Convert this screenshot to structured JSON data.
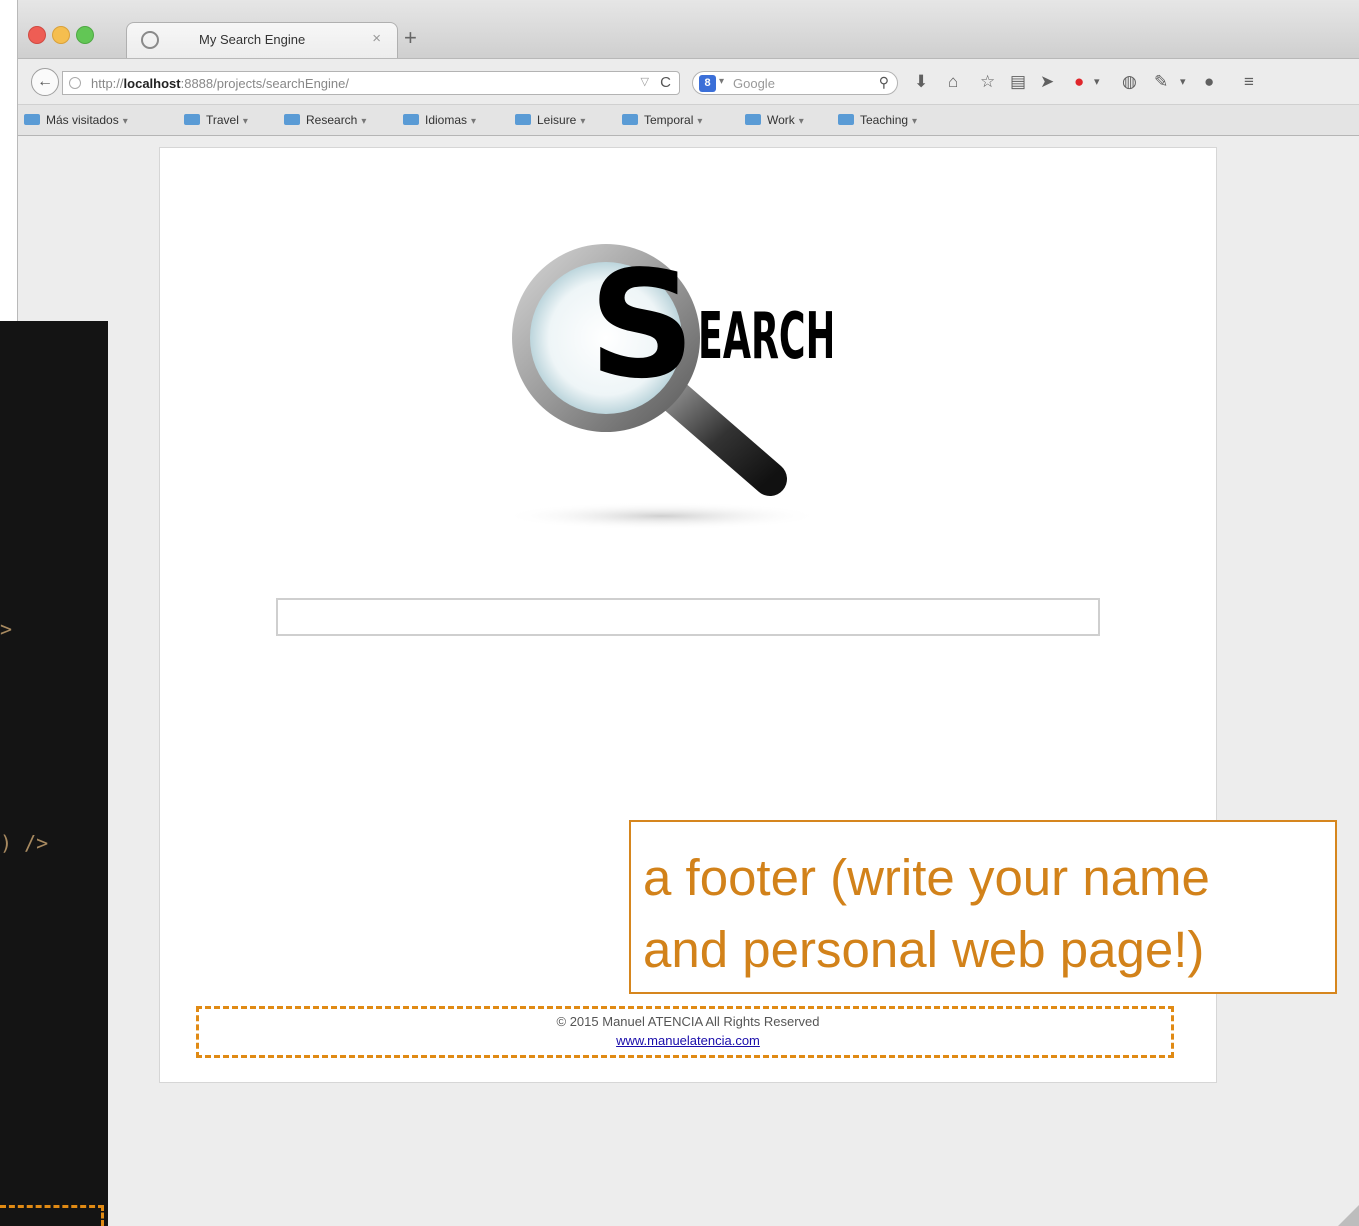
{
  "browser": {
    "tab_title": "My Search Engine",
    "tab_close": "×",
    "new_tab": "+",
    "url_prefix": "http://",
    "url_host": "localhost",
    "url_rest": ":8888/projects/searchEngine/",
    "url_dropdown": "▽",
    "reload": "C",
    "search_engine_badge": "8",
    "search_placeholder": "Google",
    "bookmarks": [
      {
        "label": "Más visitados"
      },
      {
        "label": "Travel"
      },
      {
        "label": "Research"
      },
      {
        "label": "Idiomas"
      },
      {
        "label": "Leisure"
      },
      {
        "label": "Temporal"
      },
      {
        "label": "Work"
      },
      {
        "label": "Teaching"
      }
    ]
  },
  "page": {
    "logo_letter": "S",
    "logo_text": "EARCH",
    "footer_copyright": "© 2015 Manuel ATENCIA All Rights Reserved",
    "footer_link": "www.manuelatencia.com"
  },
  "overlay": {
    "code_fragment_1": ">",
    "code_fragment_2": ") />",
    "callout_line1": "a footer (write your name",
    "callout_line2": "and personal web page!)"
  },
  "colors": {
    "annotation": "#d6861e",
    "code_bg": "#141414",
    "link": "#1a0dab"
  }
}
